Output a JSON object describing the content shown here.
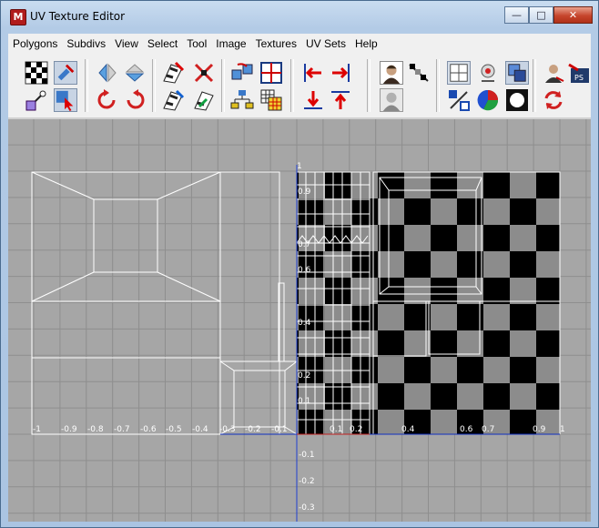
{
  "window": {
    "title": "UV Texture Editor",
    "app_icon": "maya-icon"
  },
  "window_buttons": {
    "minimize": "—",
    "maximize": "□",
    "close": "✕"
  },
  "menu": [
    "Polygons",
    "Subdivs",
    "View",
    "Select",
    "Tool",
    "Image",
    "Textures",
    "UV Sets",
    "Help"
  ],
  "viewport": {
    "u_labels": [
      "-1",
      "-0.9",
      "-0.8",
      "-0.7",
      "-0.6",
      "-0.5",
      "-0.4",
      "-0.3",
      "-0.2",
      "-0.1",
      "0.1",
      "0.2",
      "0.4",
      "0.6",
      "0.7",
      "0.9",
      "1"
    ],
    "v_labels": [
      "1",
      "0.9",
      "0.7",
      "0.6",
      "0.4",
      "0.2",
      "0.1",
      "-0.1",
      "-0.2",
      "-0.3"
    ],
    "colors": {
      "background": "#a6a6a6",
      "grid": "#8e8e8e",
      "wire": "#ffffff",
      "u_axis": "#1030c0",
      "v_axis": "#2040d0",
      "checker_dark": "#000000",
      "checker_light": "#8c8c8c"
    }
  }
}
